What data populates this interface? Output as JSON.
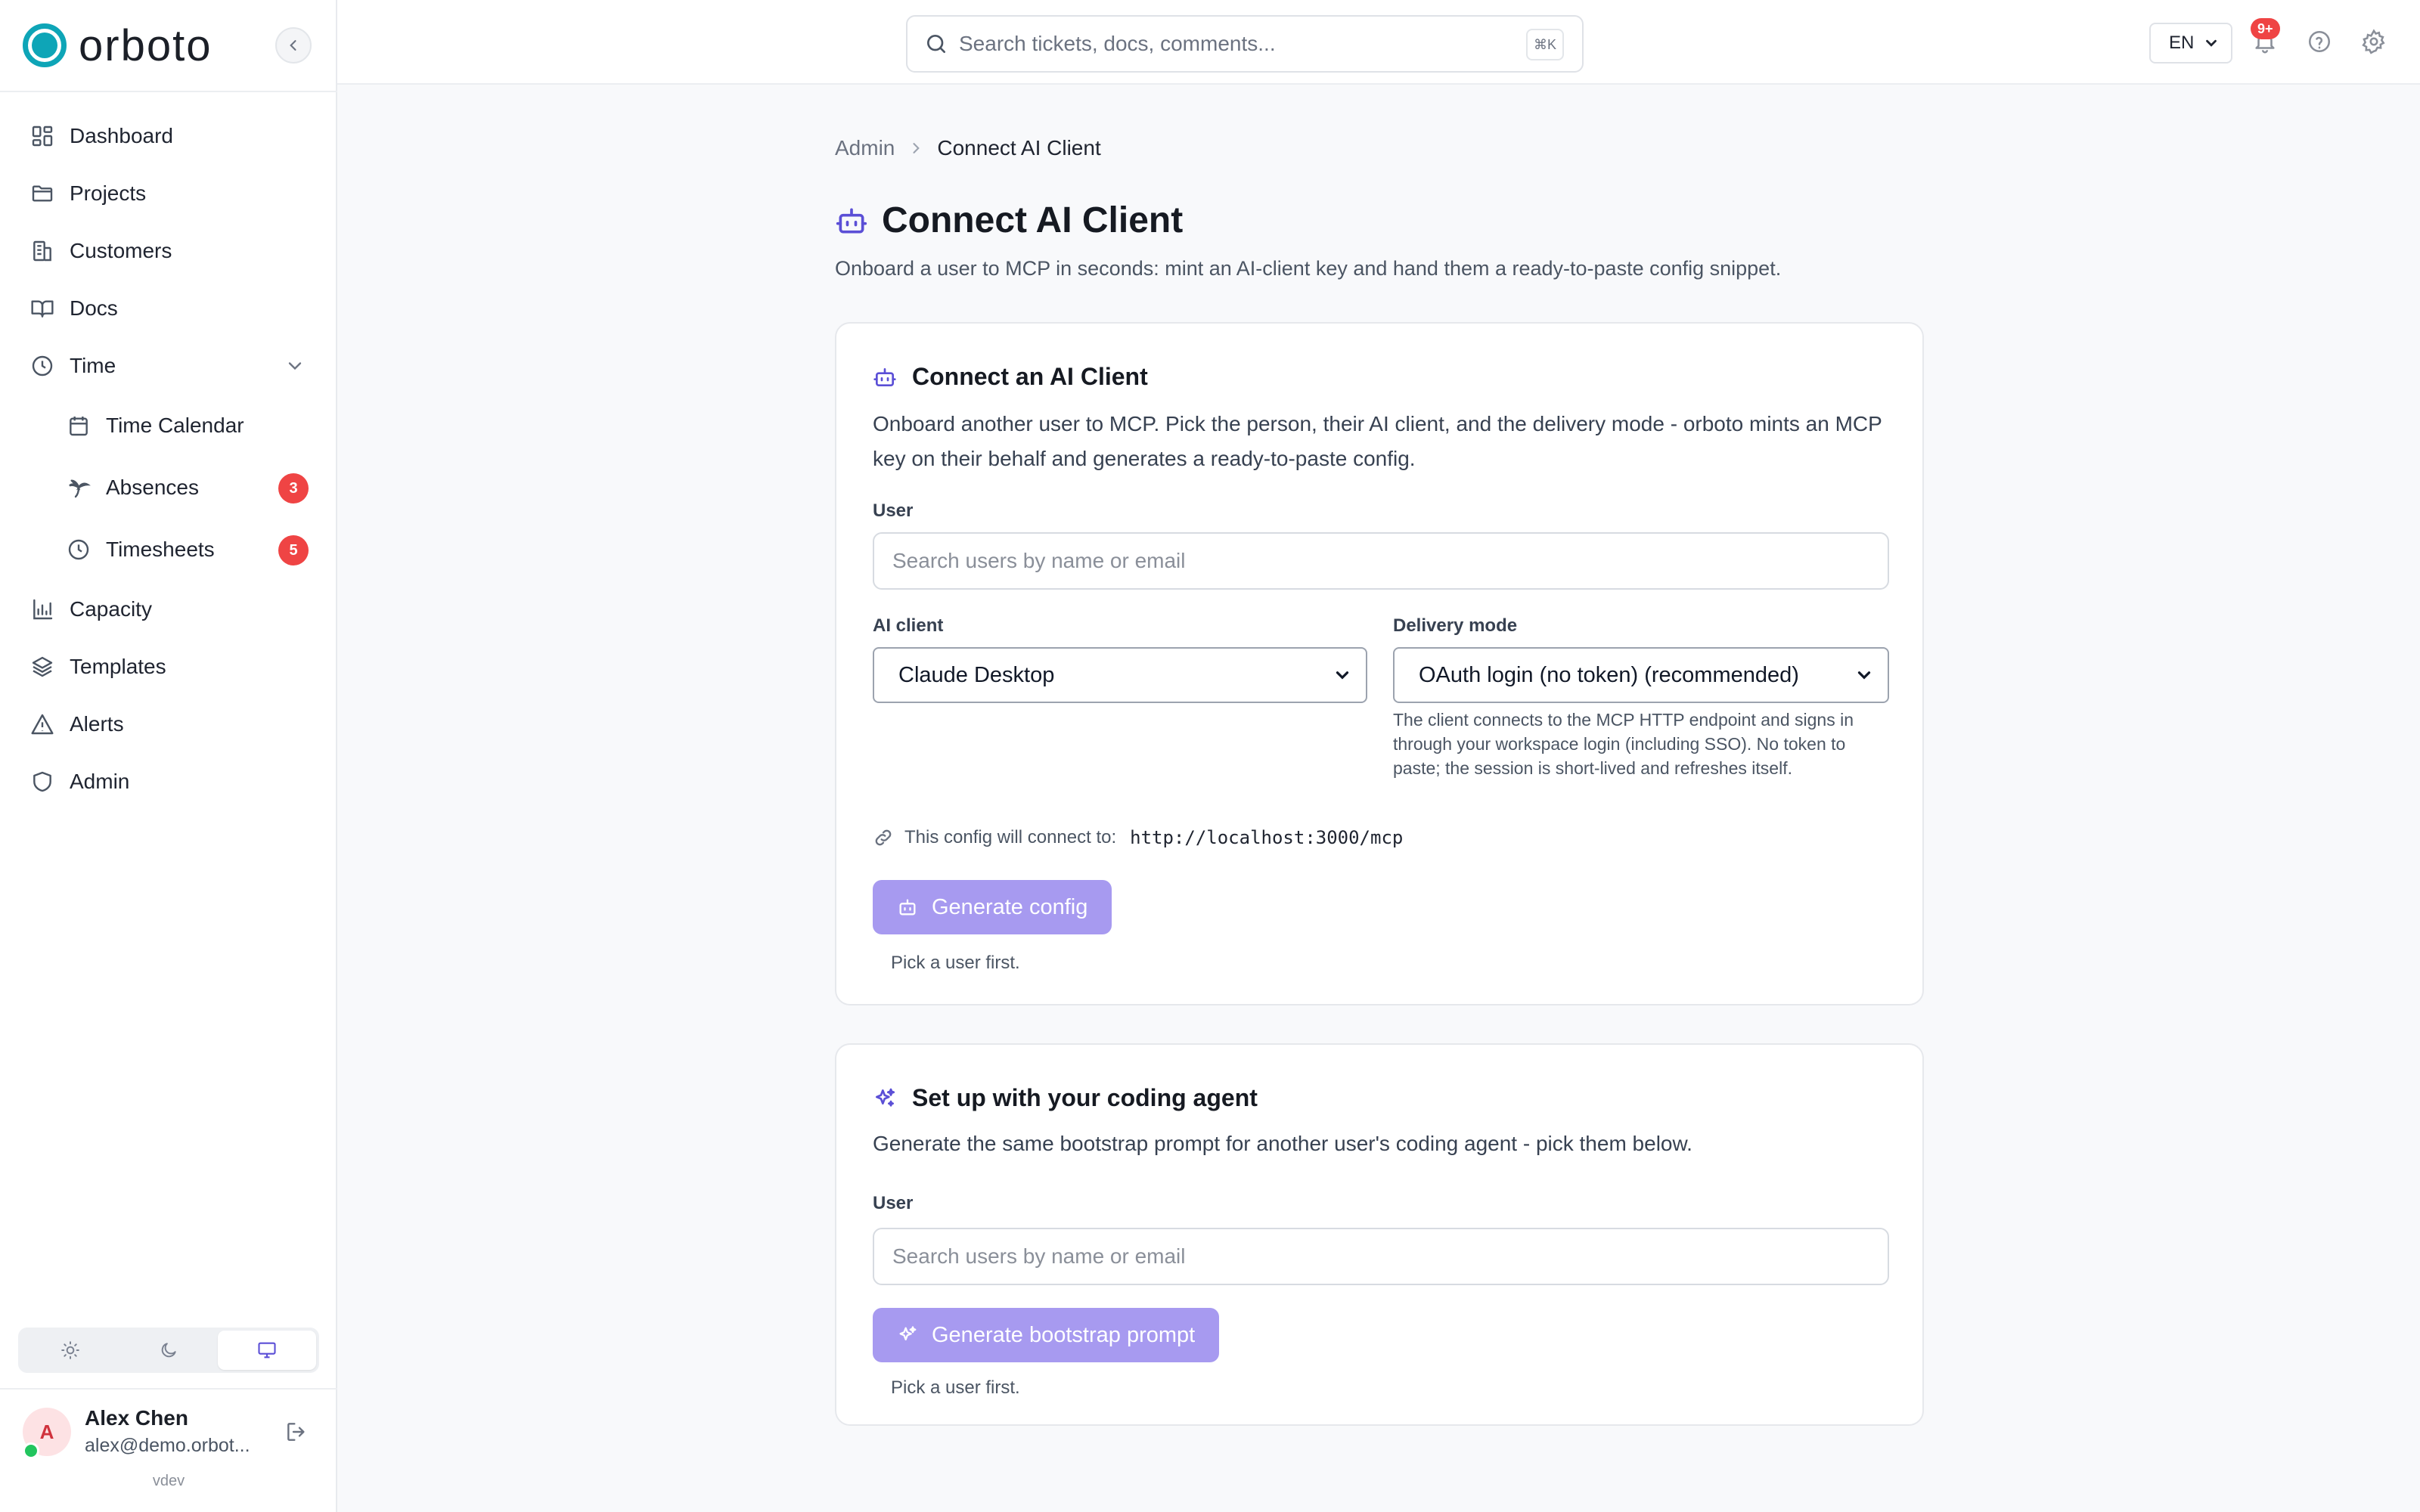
{
  "brand": {
    "name": "orboto"
  },
  "sidebar": {
    "items": [
      {
        "label": "Dashboard",
        "icon": "dashboard-icon"
      },
      {
        "label": "Projects",
        "icon": "folder-icon"
      },
      {
        "label": "Customers",
        "icon": "building-icon"
      },
      {
        "label": "Docs",
        "icon": "book-icon"
      },
      {
        "label": "Time",
        "icon": "clock-icon",
        "expanded": true
      },
      {
        "label": "Time Calendar",
        "icon": "calendar-icon",
        "sub": true
      },
      {
        "label": "Absences",
        "icon": "palm-tree-icon",
        "sub": true,
        "badge": "3"
      },
      {
        "label": "Timesheets",
        "icon": "clock-icon",
        "sub": true,
        "badge": "5"
      },
      {
        "label": "Capacity",
        "icon": "bar-chart-icon"
      },
      {
        "label": "Templates",
        "icon": "layers-icon"
      },
      {
        "label": "Alerts",
        "icon": "alert-triangle-icon"
      },
      {
        "label": "Admin",
        "icon": "shield-icon"
      }
    ],
    "theme_options": [
      "light",
      "dark",
      "system"
    ],
    "theme_selected": "system",
    "user": {
      "initial": "A",
      "name": "Alex Chen",
      "email": "alex@demo.orbot...",
      "status": "online"
    },
    "version": "vdev"
  },
  "topbar": {
    "search_placeholder": "Search tickets, docs, comments...",
    "shortcut": "⌘K",
    "language": "EN",
    "notifications_badge": "9+"
  },
  "breadcrumb": {
    "parent": "Admin",
    "current": "Connect AI Client"
  },
  "page": {
    "title": "Connect AI Client",
    "subtitle": "Onboard a user to MCP in seconds: mint an AI-client key and hand them a ready-to-paste config snippet."
  },
  "connect_card": {
    "title": "Connect an AI Client",
    "description": "Onboard another user to MCP. Pick the person, their AI client, and the delivery mode - orboto mints an MCP key on their behalf and generates a ready-to-paste config.",
    "user_label": "User",
    "user_placeholder": "Search users by name or email",
    "ai_client_label": "AI client",
    "ai_client_value": "Claude Desktop",
    "delivery_label": "Delivery mode",
    "delivery_value": "OAuth login (no token) (recommended)",
    "delivery_help": "The client connects to the MCP HTTP endpoint and signs in through your workspace login (including SSO). No token to paste; the session is short-lived and refreshes itself.",
    "endpoint_prefix": "This config will connect to:",
    "endpoint_url": "http://localhost:3000/mcp",
    "button_label": "Generate config",
    "hint": "Pick a user first."
  },
  "agent_card": {
    "title": "Set up with your coding agent",
    "description": "Generate the same bootstrap prompt for another user's coding agent - pick them below.",
    "user_label": "User",
    "user_placeholder": "Search users by name or email",
    "button_label": "Generate bootstrap prompt",
    "hint": "Pick a user first."
  },
  "colors": {
    "brand": "#0ea5b7",
    "primary_disabled": "#a79af0",
    "badge": "#ef4444",
    "accent": "#5b4fd6"
  }
}
